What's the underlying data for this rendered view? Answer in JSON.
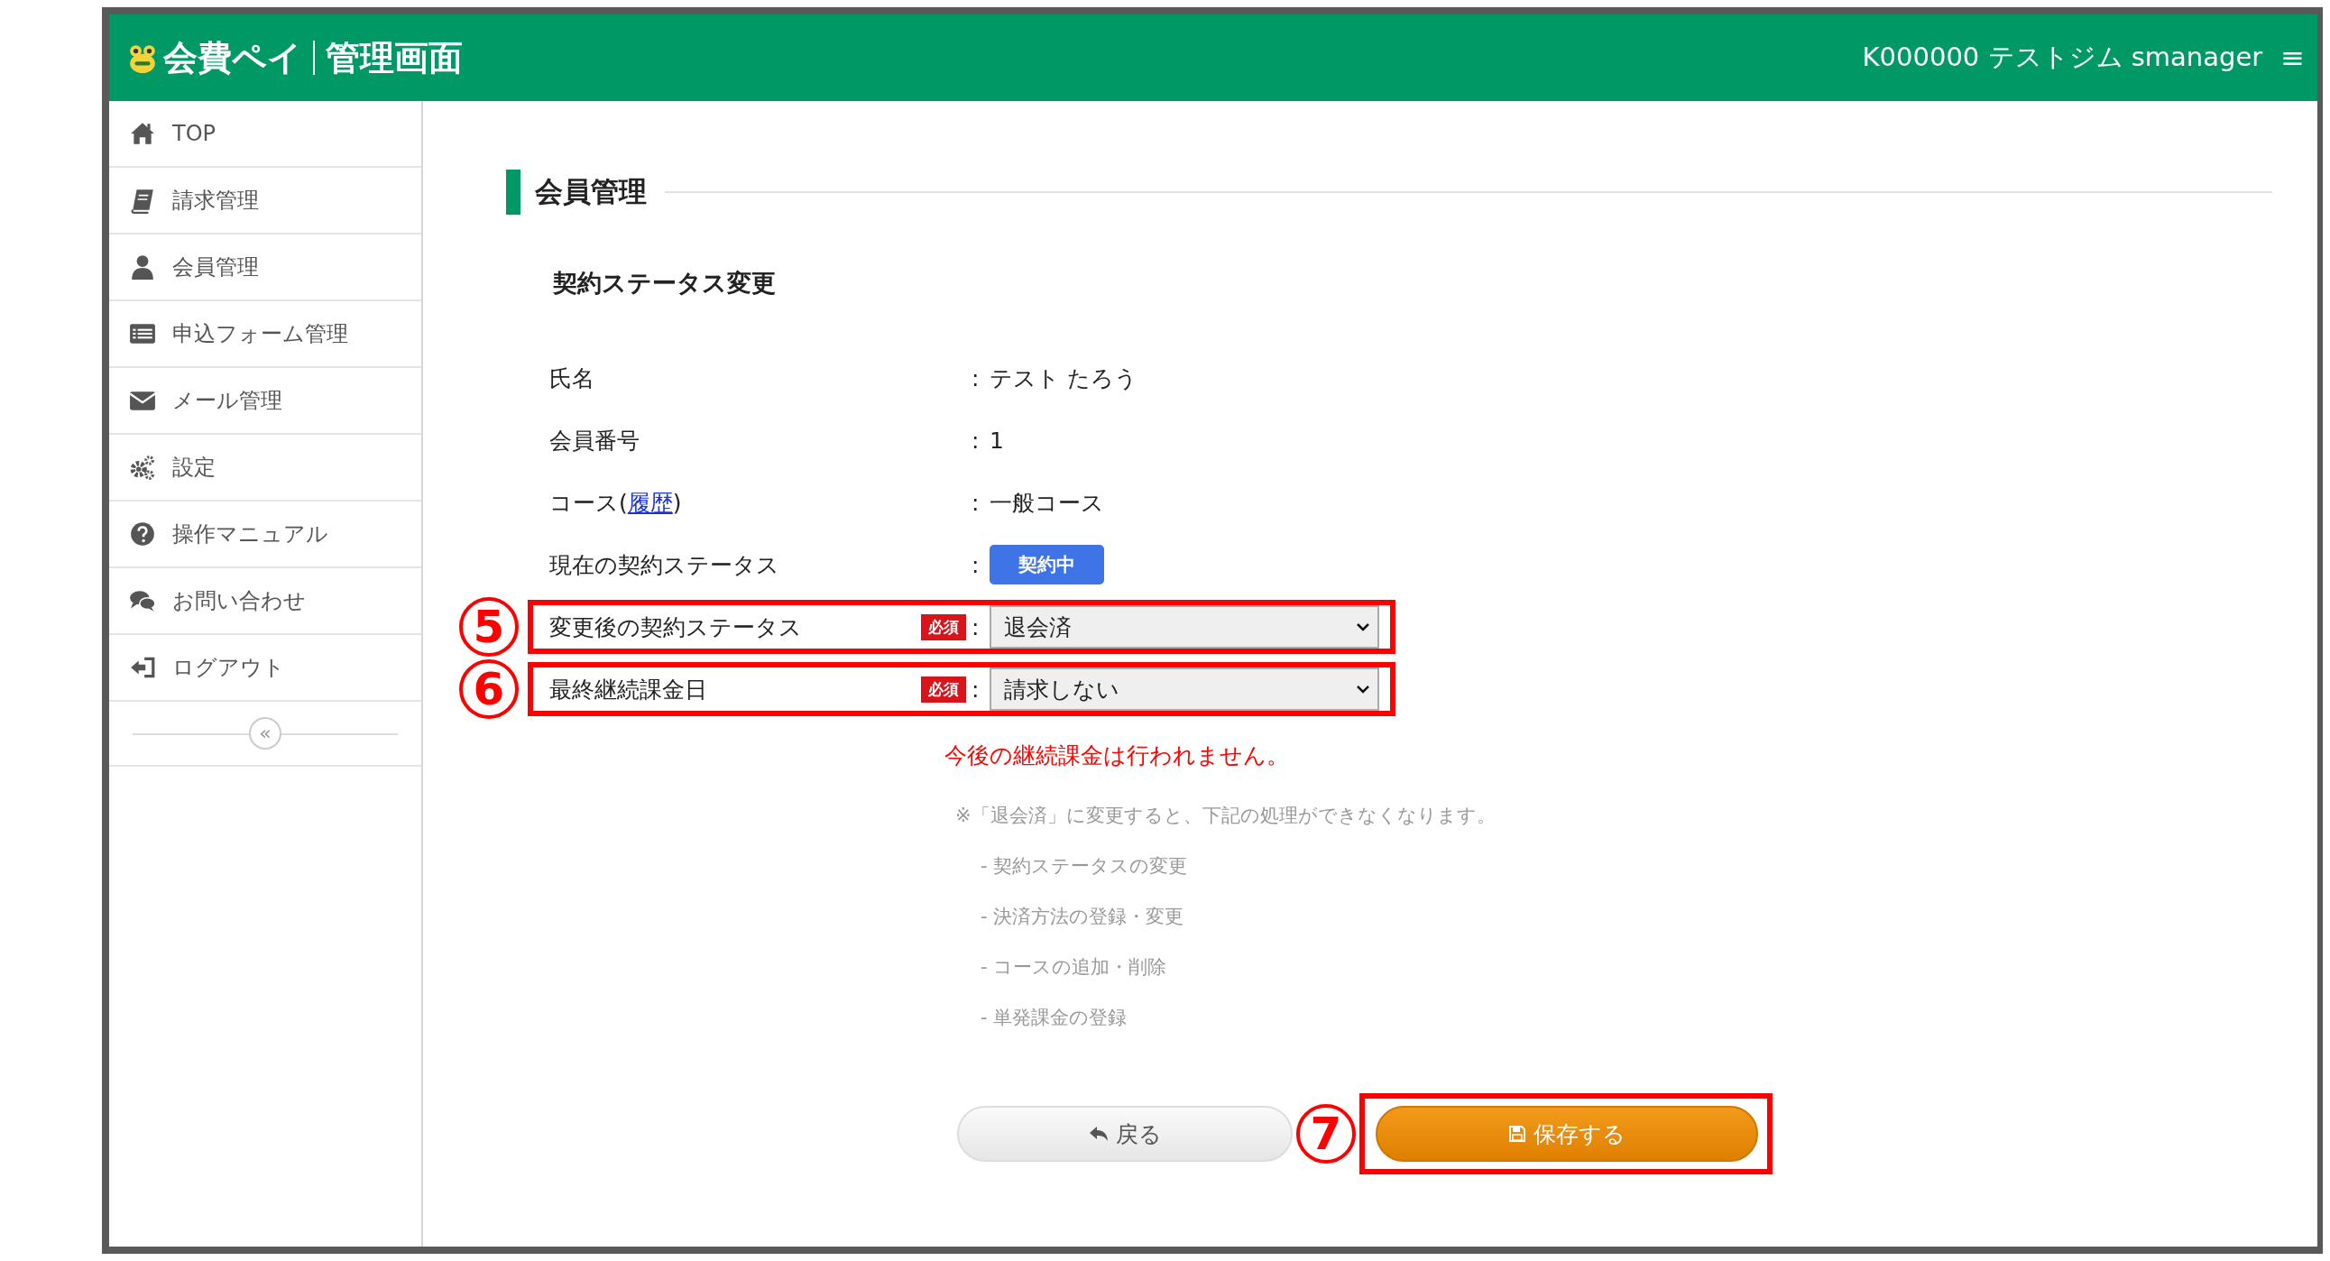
{
  "header": {
    "logo_text": "会費ペイ",
    "title": "管理画面",
    "account": "K000000 テストジム smanager",
    "menu": "≡"
  },
  "sidebar": {
    "items": [
      {
        "label": "TOP"
      },
      {
        "label": "請求管理"
      },
      {
        "label": "会員管理"
      },
      {
        "label": "申込フォーム管理"
      },
      {
        "label": "メール管理"
      },
      {
        "label": "設定"
      },
      {
        "label": "操作マニュアル"
      },
      {
        "label": "お問い合わせ"
      },
      {
        "label": "ログアウト"
      }
    ],
    "collapse": "«"
  },
  "page_title": "会員管理",
  "section_title": "契約ステータス変更",
  "fields": [
    {
      "kind": "text",
      "label": "氏名",
      "separator": ":",
      "value": "テスト たろう"
    },
    {
      "kind": "text",
      "label": "会員番号",
      "separator": ":",
      "value": "1"
    },
    {
      "kind": "link",
      "label": "コース(",
      "link": "履歴",
      "label_end": ")",
      "separator": ":",
      "value": "一般コース"
    },
    {
      "kind": "badge",
      "label": "現在の契約ステータス",
      "separator": ":",
      "value": "契約中"
    },
    {
      "kind": "select",
      "label": "変更後の契約ステータス",
      "required": "必須",
      "separator": ":",
      "value": "退会済",
      "callout": "5"
    },
    {
      "kind": "select",
      "label": "最終継続課金日",
      "required": "必須",
      "separator": ":",
      "value": "請求しない",
      "callout": "6"
    }
  ],
  "warning": "今後の継続課金は行われません。",
  "note": {
    "text": "※「退会済」に変更すると、下記の処理ができなくなります。",
    "items": [
      "- 契約ステータスの変更",
      "- 決済方法の登録・変更",
      "- コースの追加・削除",
      "- 単発課金の登録"
    ]
  },
  "buttons": [
    {
      "kind": "back",
      "label": "戻る"
    },
    {
      "kind": "save",
      "label": "保存する",
      "callout": "7"
    }
  ]
}
